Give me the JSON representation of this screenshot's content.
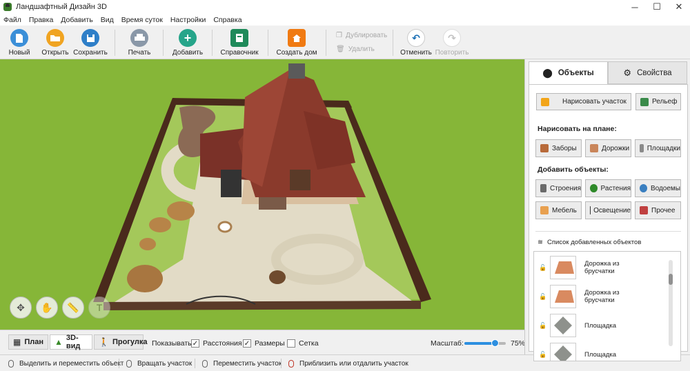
{
  "window": {
    "title": "Ландшафтный Дизайн 3D",
    "minimize": "─",
    "maximize": "☐",
    "close": "✕"
  },
  "menu": [
    "Файл",
    "Правка",
    "Добавить",
    "Вид",
    "Время суток",
    "Настройки",
    "Справка"
  ],
  "toolbar": {
    "new": "Новый",
    "open": "Открыть",
    "save": "Сохранить",
    "print": "Печать",
    "add": "Добавить",
    "reference": "Справочник",
    "build_house": "Создать дом",
    "duplicate": "Дублировать",
    "delete": "Удалить",
    "undo": "Отменить",
    "redo": "Повторить"
  },
  "view_tabs": {
    "plan": "План",
    "view3d": "3D-вид",
    "walk": "Прогулка"
  },
  "show": {
    "label": "Показывать:",
    "distances": "Расстояния",
    "sizes": "Размеры",
    "grid": "Сетка",
    "distances_checked": true,
    "sizes_checked": true,
    "grid_checked": false
  },
  "zoom": {
    "label": "Масштаб:",
    "value": "75%",
    "level_fraction": 0.75
  },
  "status": [
    "Выделить и переместить объект",
    "Вращать участок",
    "Переместить участок",
    "Приблизить или отдалить участок"
  ],
  "panel": {
    "tabs": {
      "objects": "Объекты",
      "properties": "Свойства"
    },
    "draw_plot": "Нарисовать участок",
    "relief": "Рельеф",
    "draw_on_plan": "Нарисовать на плане:",
    "fences": "Заборы",
    "paths": "Дорожки",
    "areas": "Площадки",
    "add_objects": "Добавить объекты:",
    "buildings": "Строения",
    "plants": "Растения",
    "ponds": "Водоемы",
    "furniture": "Мебель",
    "lighting": "Освещение",
    "other": "Прочее",
    "list_title": "Список добавленных объектов",
    "items": [
      {
        "name": "Дорожка из брусчатки",
        "kind": "brick"
      },
      {
        "name": "Дорожка из брусчатки",
        "kind": "brick"
      },
      {
        "name": "Площадка",
        "kind": "stone"
      },
      {
        "name": "Площадка",
        "kind": "stone"
      }
    ]
  },
  "colors": {
    "grass": "#8cbb3a",
    "roof": "#8a3a2c",
    "fence": "#4a2a1c",
    "path": "#e2dbc6",
    "accent": "#2d8fe0"
  }
}
